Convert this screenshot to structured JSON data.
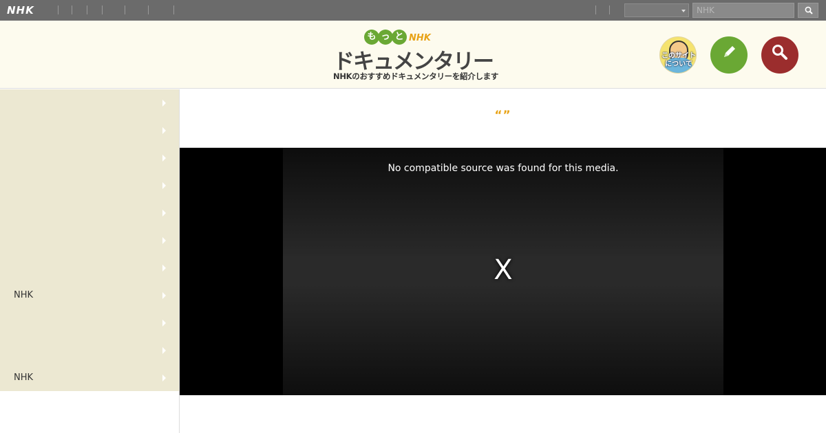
{
  "topbar": {
    "logo": "NHK",
    "select_value": "",
    "search_placeholder": "NHK"
  },
  "header": {
    "brand_motto": [
      "も",
      "っ",
      "と"
    ],
    "brand_nhk": "NHK",
    "brand_title": "ドキュメンタリー",
    "brand_subtitle": "NHKのおすすめドキュメンタリーを紹介します",
    "about_label": "このサイトについて"
  },
  "sidebar": {
    "items": [
      {
        "label": ""
      },
      {
        "label": ""
      },
      {
        "label": ""
      },
      {
        "label": ""
      },
      {
        "label": ""
      },
      {
        "label": ""
      },
      {
        "label": ""
      },
      {
        "label": "NHK"
      },
      {
        "label": ""
      },
      {
        "label": ""
      },
      {
        "label": "NHK"
      }
    ]
  },
  "main": {
    "quote": "“”",
    "player_message": "No compatible source was found for this media.",
    "player_close": "X"
  },
  "icons": {
    "search": "search-icon",
    "edit": "pencil-icon",
    "chevron": "chevron-right-icon"
  },
  "colors": {
    "topbar": "#6b6b6b",
    "header_bg": "#fdfbee",
    "sidebar_bg": "#ece8d2",
    "accent_green": "#6aa834",
    "accent_red": "#9b2d2d",
    "accent_orange": "#e8a317"
  }
}
